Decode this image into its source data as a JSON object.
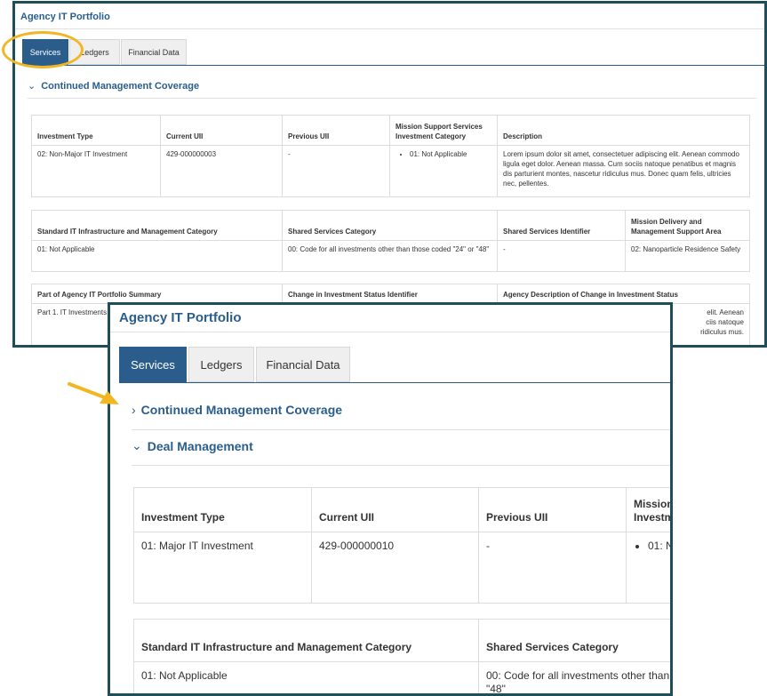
{
  "back_panel": {
    "title": "Agency IT Portfolio",
    "tabs": [
      "Services",
      "Ledgers",
      "Financial Data"
    ],
    "section": "Continued Management Coverage",
    "table1": {
      "headers": [
        "Investment Type",
        "Current UII",
        "Previous UII",
        "Mission Support Services Investment Category",
        "Description"
      ],
      "row": [
        "02: Non-Major IT Investment",
        "429-000000003",
        "-",
        "01: Not Applicable",
        "Lorem ipsum dolor sit amet, consectetuer adipiscing elit. Aenean commodo ligula eget dolor. Aenean massa. Cum sociis natoque penatibus et magnis dis parturient montes, nascetur ridiculus mus. Donec quam felis, ultricies nec, pellentes."
      ]
    },
    "table2": {
      "headers": [
        "Standard IT Infrastructure and Management Category",
        "Shared Services Category",
        "Shared Services Identifier",
        "Mission Delivery and Management Support Area"
      ],
      "row": [
        "01: Not Applicable",
        "00: Code for all investments other than those coded \"24\" or \"48\"",
        "-",
        "02: Nanoparticle Residence Safety"
      ]
    },
    "table3": {
      "headers": [
        "Part of Agency IT Portfolio Summary",
        "Change in Investment Status Identifier",
        "Agency Description of Change in Investment Status"
      ],
      "row": [
        "Part 1. IT Investments",
        "",
        ""
      ],
      "peek_lines": [
        "elit. Aenean",
        "ciis natoque",
        "ridiculus mus."
      ]
    }
  },
  "front_panel": {
    "title": "Agency IT Portfolio",
    "tabs": [
      "Services",
      "Ledgers",
      "Financial Data"
    ],
    "section_collapsed": "Continued Management Coverage",
    "section_expanded": "Deal Management",
    "table1": {
      "headers": [
        "Investment Type",
        "Current UII",
        "Previous UII",
        "Mission",
        "Investm"
      ],
      "row": [
        "01: Major IT Investment",
        "429-000000010",
        "-",
        "01: N"
      ]
    },
    "table2": {
      "headers": [
        "Standard IT Infrastructure and Management Category",
        "Shared Services Category"
      ],
      "row": [
        "01: Not Applicable",
        "00: Code for all investments other than th"
      ],
      "row_wrap": "\"48\""
    }
  },
  "colors": {
    "brand": "#2a5d8c",
    "frame": "#1f4e5a",
    "highlight": "#f2b623"
  }
}
